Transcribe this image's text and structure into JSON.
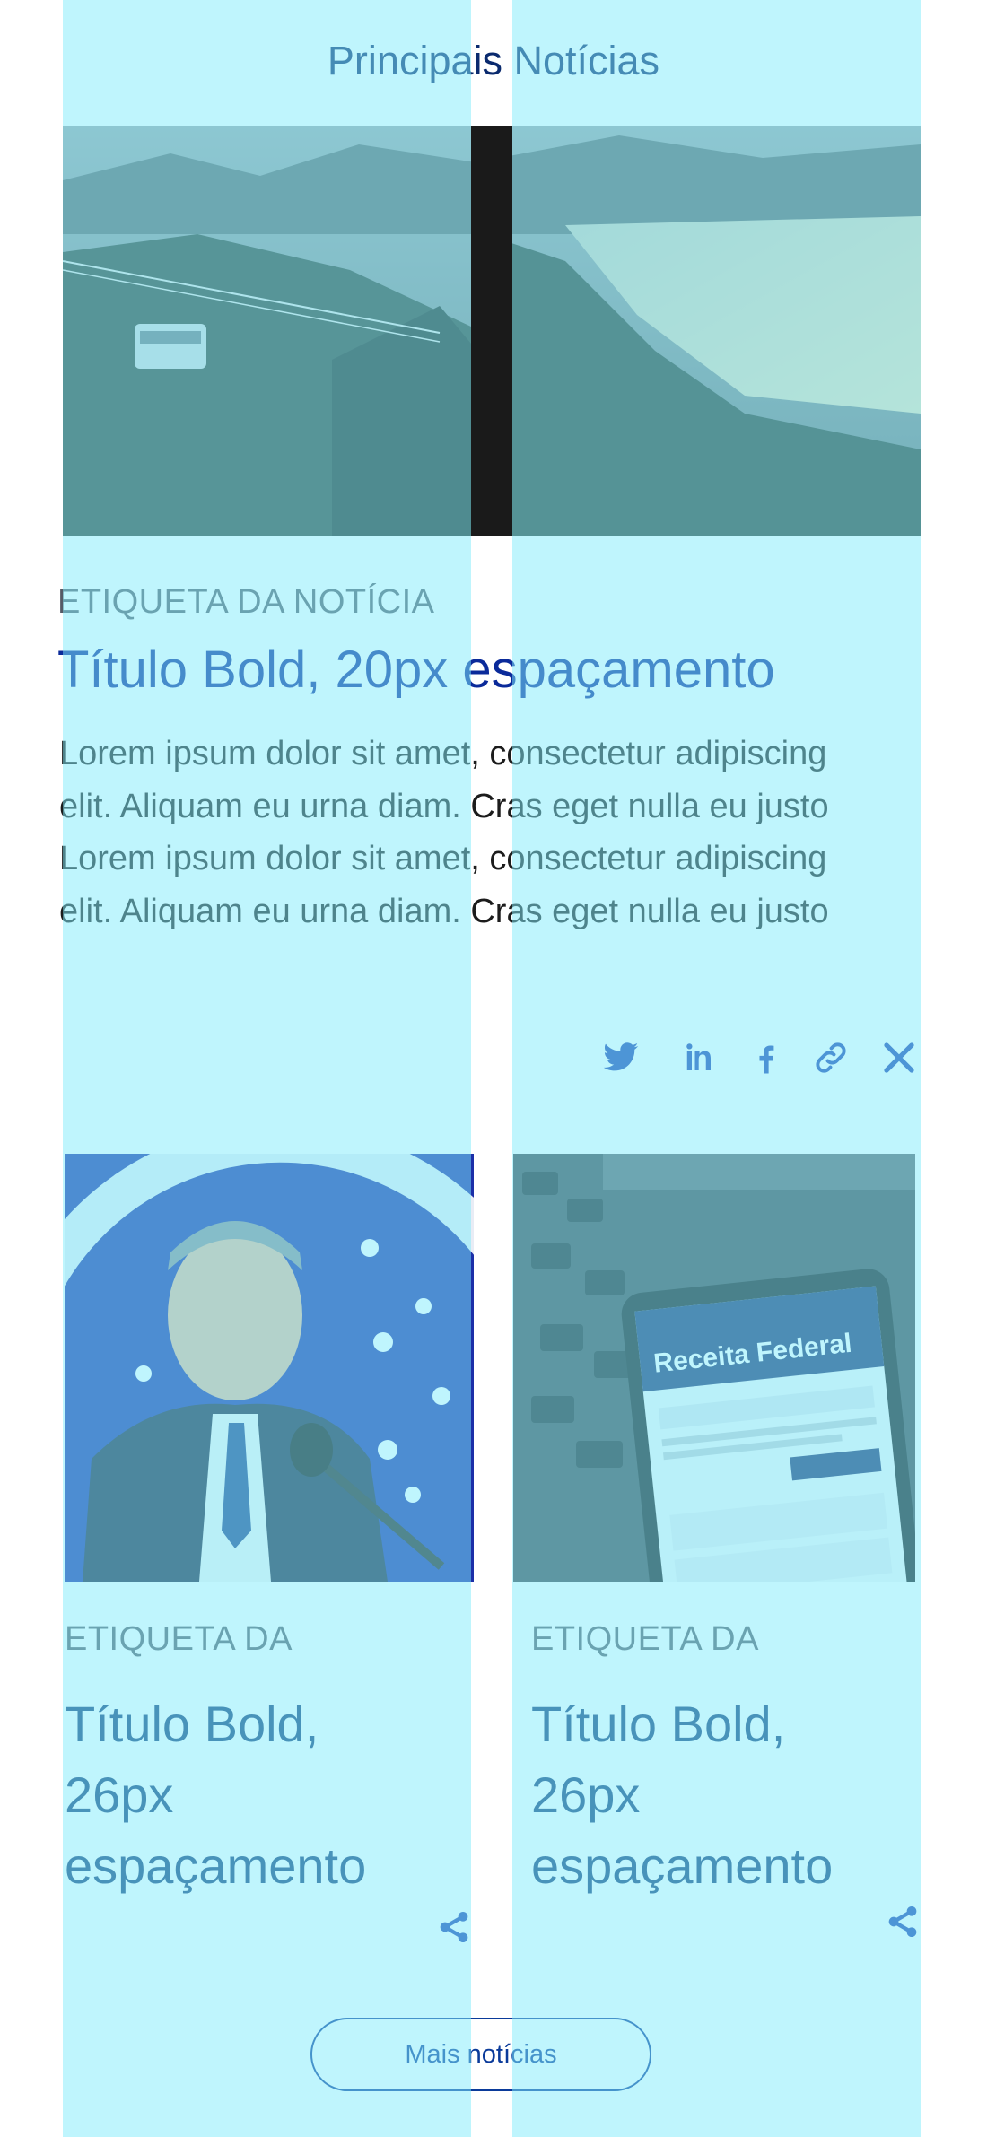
{
  "section": {
    "title": "Principais Notícias"
  },
  "hero": {
    "tag": "ETIQUETA DA NOTÍCIA",
    "title": "Título Bold, 20px espaçamento",
    "body": "Lorem ipsum dolor sit amet, consectetur adipiscing elit. Aliquam eu urna diam. Cras eget nulla eu justo Lorem ipsum dolor sit amet, consectetur adipiscing elit. Aliquam eu urna diam. Cras eget nulla eu justo",
    "share_icons": [
      "twitter-icon",
      "linkedin-icon",
      "facebook-icon",
      "link-icon",
      "x-icon"
    ]
  },
  "cards": [
    {
      "tag": "ETIQUETA DA",
      "title": "Título Bold, 26px espaçamento",
      "share_icon": "share-icon"
    },
    {
      "tag": "ETIQUETA DA",
      "title": "Título Bold, 26px espaçamento",
      "share_icon": "share-icon"
    }
  ],
  "more_button": {
    "label": "Mais notícias"
  },
  "colors": {
    "overlay": "#80ebfc",
    "title_blue": "#0a2a9a",
    "accent_blue": "#1a3fb0"
  }
}
